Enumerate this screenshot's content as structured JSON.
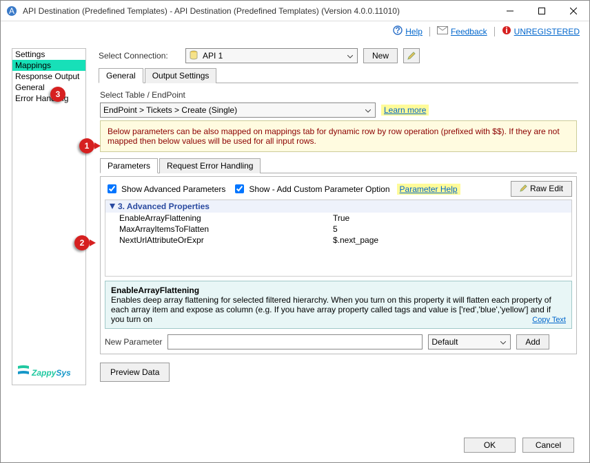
{
  "window": {
    "title": "API Destination (Predefined Templates) - API Destination (Predefined Templates) (Version 4.0.0.11010)"
  },
  "header": {
    "help": "Help",
    "feedback": "Feedback",
    "unregistered": "UNREGISTERED"
  },
  "sidebar": {
    "items": [
      {
        "label": "Settings"
      },
      {
        "label": "Mappings"
      },
      {
        "label": "Response Output"
      },
      {
        "label": "General"
      },
      {
        "label": "Error Handling"
      }
    ],
    "active_index": 1,
    "logo_text": "ZappySys"
  },
  "callouts": {
    "one": "1",
    "two": "2",
    "three": "3"
  },
  "connection": {
    "label": "Select Connection:",
    "value": "API 1",
    "new_btn": "New"
  },
  "top_tabs": [
    {
      "label": "General",
      "active": true
    },
    {
      "label": "Output Settings",
      "active": false
    }
  ],
  "endpoint": {
    "label": "Select Table / EndPoint",
    "value": "EndPoint > Tickets > Create            (Single)",
    "learn_more": "Learn more"
  },
  "info_banner": "Below parameters can be also mapped on mappings tab for dynamic row by row operation (prefixed with $$). If they are not mapped then below values will be used for all input rows.",
  "param_tabs": [
    {
      "label": "Parameters",
      "active": true
    },
    {
      "label": "Request Error Handling",
      "active": false
    }
  ],
  "options": {
    "adv_label": "Show Advanced Parameters",
    "custom_label": "Show - Add Custom Parameter Option",
    "param_help": "Parameter Help",
    "raw_edit": "Raw Edit"
  },
  "props": {
    "section": "3. Advanced Properties",
    "rows": [
      {
        "name": "EnableArrayFlattening",
        "value": "True"
      },
      {
        "name": "MaxArrayItemsToFlatten",
        "value": "5"
      },
      {
        "name": "NextUrlAttributeOrExpr",
        "value": "$.next_page"
      }
    ]
  },
  "helpbox": {
    "title": "EnableArrayFlattening",
    "text": "Enables deep array flattening for selected filtered hierarchy. When you turn on this property it will flatten each property of each array item and expose as column (e.g. If you have array property called tags and value is ['red','blue','yellow'] and if you turn on",
    "copy": "Copy Text"
  },
  "newparam": {
    "label": "New Parameter",
    "default": "Default",
    "add": "Add"
  },
  "preview_btn": "Preview Data",
  "footer": {
    "ok": "OK",
    "cancel": "Cancel"
  }
}
